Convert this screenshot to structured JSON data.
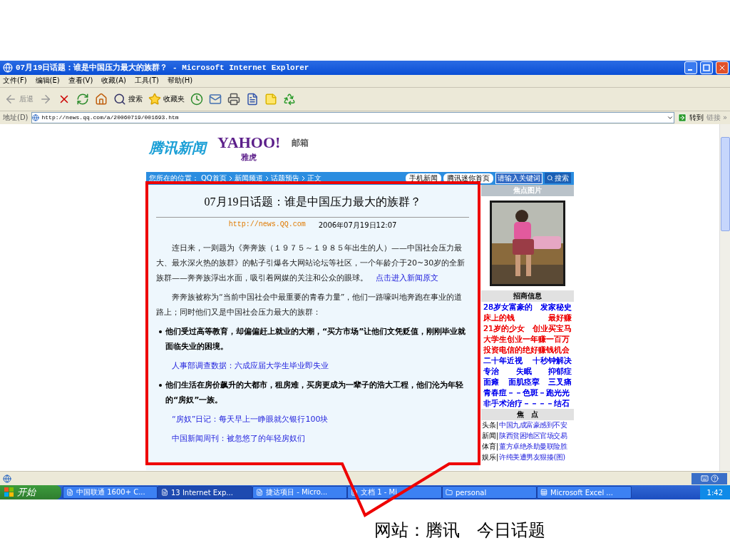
{
  "window": {
    "title": "07月19日话题：谁是中国压力最大的族群？ - Microsoft Internet Explorer"
  },
  "menu": [
    "文件(F)",
    "编辑(E)",
    "查看(V)",
    "收藏(A)",
    "工具(T)",
    "帮助(H)"
  ],
  "toolbar": {
    "back": "后退",
    "search": "搜索",
    "favorites": "收藏夹"
  },
  "address_bar": {
    "label": "地址(D)",
    "url": "http://news.qq.com/a/20060719/001693.htm",
    "go": "转到",
    "links": "链接 »"
  },
  "page": {
    "logo": {
      "name": "腾讯新闻",
      "partner": "YAHOO!",
      "partner_sub": "雅虎",
      "mail": "邮箱"
    },
    "breadcrumb": {
      "label": "您所在的位置：",
      "items": [
        "QQ首页",
        "新闻频道",
        "话题预告",
        "正文"
      ]
    },
    "nav_buttons": [
      "手机新闻",
      "腾讯迷你首页"
    ],
    "search": {
      "value": "请输入关键词",
      "button": "搜索"
    },
    "article": {
      "title": "07月19日话题：谁是中国压力最大的族群？",
      "source": "http://news.QQ.com",
      "date": "2006年07月19日12:07",
      "blocks": [
        {
          "kind": "paragraph",
          "text": "连日来，一则题为《奔奔族（１９７５～１９８５年出生的人）——中国社会压力最大、最水深火热的族群》的帖子引爆各大网站论坛等社区，一个年龄介于20~30岁的全新族群——奔奔族浮出水面，吸引着网媒的关注和公众的眼球。",
          "link": "点击进入新闻原文"
        },
        {
          "kind": "paragraph",
          "text": "奔奔族被称为“当前中国社会中最重要的青春力量”，他们一路嚎叫地奔跑在事业的道路上；同时他们又是中国社会压力最大的族群："
        },
        {
          "kind": "bullet",
          "text": "他们受过高等教育，却偏偏赶上就业的大潮，“买方市场”让他们文凭贬值，刚刚毕业就面临失业的困境。"
        },
        {
          "kind": "link",
          "text": "人事部调查数据：六成应届大学生毕业即失业"
        },
        {
          "kind": "bullet",
          "text": "他们生活在房价飙升的大都市，租房难，买房更成为一辈子的浩大工程，他们沦为年轻的“房奴”一族。"
        },
        {
          "kind": "link",
          "text": "“房奴”日记：每天早上一睁眼就欠银行100块"
        },
        {
          "kind": "link",
          "text": "中国新闻周刊：被忽悠了的年轻房奴们"
        }
      ]
    },
    "sidebar": {
      "photo_header": "焦点图片",
      "ads_header": "招商信息",
      "ads": [
        {
          "parts": [
            "28岁女富豪的",
            "发家秘史"
          ],
          "color": "#0000ee"
        },
        {
          "parts": [
            "床上的钱",
            "最好赚"
          ],
          "color": "#ee0000"
        },
        {
          "parts": [
            "21岁的少女",
            "创业买宝马"
          ],
          "color": "#ee0000"
        },
        {
          "parts": [
            "大学生创业一年赚一百万"
          ],
          "color": "#ee0000"
        },
        {
          "parts": [
            "投资电信的绝好赚钱机会"
          ],
          "color": "#ee0000"
        },
        {
          "parts": [
            "二十年近视",
            "十秒钟解决"
          ],
          "color": "#0000ee"
        },
        {
          "parts": [
            "专治",
            "失眠",
            "抑郁症"
          ],
          "color": "#0000ee"
        },
        {
          "parts": [
            "面瘫",
            "面肌痉挛",
            "三叉痛"
          ],
          "color": "#0000ee"
        },
        {
          "parts": [
            "青春痘－－色斑－跑光光"
          ],
          "color": "#0000ee"
        },
        {
          "parts": [
            "非手术治疗－－－－结石"
          ],
          "color": "#0000ee"
        }
      ],
      "focus_header": "焦　点",
      "focus": [
        {
          "category": "头条|",
          "title": "中国九成富豪感到不安"
        },
        {
          "category": "新闻|",
          "title": "陕西贫困地区官场交易"
        },
        {
          "category": "体育|",
          "title": "董方卓绝杀助曼联险胜"
        },
        {
          "category": "娱乐|",
          "title": "许纯美遭男友狠揍(图)"
        }
      ]
    }
  },
  "taskbar": {
    "start": "开始",
    "items": [
      {
        "label": "中国联通 1600+ C...",
        "selected": false
      },
      {
        "label": "13 Internet Exp...",
        "selected": true
      },
      {
        "label": "捷达项目 - Micro...",
        "selected": false
      },
      {
        "label": "文档 1 - Mi",
        "selected": false
      },
      {
        "label": "personal",
        "selected": false
      },
      {
        "label": "Microsoft Excel ...",
        "selected": false
      }
    ],
    "clock": "1:42"
  },
  "callout": {
    "text": "网站：腾讯　今日话题"
  }
}
